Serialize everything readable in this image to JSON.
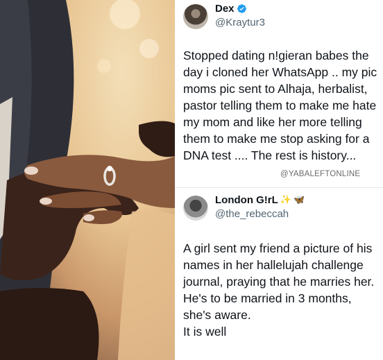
{
  "tweets": [
    {
      "display_name": "Dex",
      "handle": "@Kraytur3",
      "verified": true,
      "text": "Stopped dating n!gieran babes the day i cloned her WhatsApp .. my pic moms pic sent to Alhaja, herbalist, pastor telling them to make me hate my mom and like her more telling them to make me stop asking for a DNA test .... The rest is history..."
    },
    {
      "display_name": "London G!rL",
      "name_emojis": [
        "✨",
        "🦋"
      ],
      "handle": "@the_rebeccah",
      "text": "A girl sent my friend a picture of his names in her hallelujah challenge journal, praying that he marries her.\nHe's to be married in 3 months, she's aware.\nIt is well"
    }
  ],
  "watermark": "@YABALEFTONLINE",
  "colors": {
    "verified_badge": "#1d9bf0",
    "handle": "#536471",
    "text": "#0f1419"
  },
  "icons": {
    "verified": "verified-badge-icon",
    "sparkles": "sparkles-icon",
    "butterfly": "butterfly-icon"
  }
}
